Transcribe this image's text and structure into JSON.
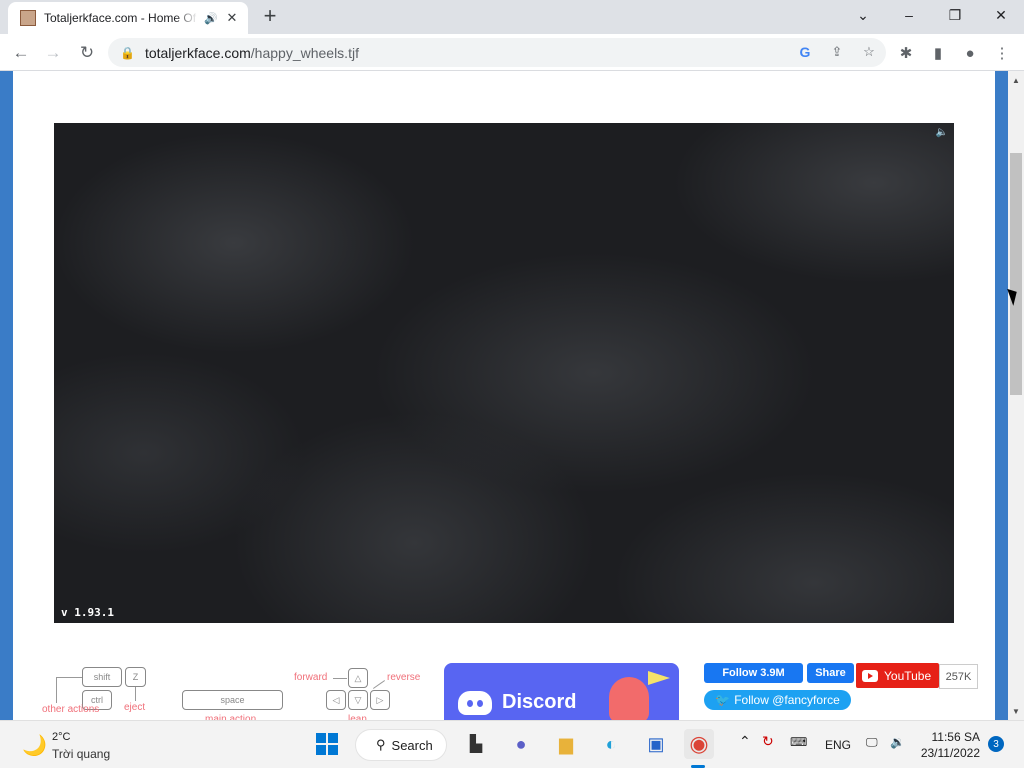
{
  "browser": {
    "tab": {
      "title": "Totaljerkface.com - Home Of",
      "audio_icon": "speaker-icon",
      "close": "✕"
    },
    "new_tab": "+",
    "window_controls": {
      "minimize": "–",
      "maximize": "❐",
      "close": "✕",
      "tab_search": "⌄"
    },
    "address": {
      "host": "totaljerkface.com",
      "path": "/happy_wheels.tjf"
    }
  },
  "game": {
    "version": "v 1.93.1",
    "sound_icon": "speaker-icon"
  },
  "controls": {
    "keys": {
      "shift": "shift",
      "z": "Z",
      "ctrl": "ctrl",
      "space": "space"
    },
    "labels": {
      "other_actions": "other actions",
      "eject": "eject",
      "main_action": "main action",
      "forward": "forward",
      "reverse": "reverse",
      "lean": "lean"
    }
  },
  "discord": {
    "label": "Discord"
  },
  "social": {
    "facebook_follow": "Follow 3.9M",
    "facebook_share": "Share",
    "youtube": "YouTube",
    "youtube_count": "257K",
    "twitter": "Follow @fancyforce"
  },
  "taskbar": {
    "weather": {
      "temp": "2°C",
      "desc": "Trời quang"
    },
    "search": "Search",
    "language": "ENG",
    "time": "11:56 SA",
    "date": "23/11/2022",
    "notifications": "3"
  }
}
